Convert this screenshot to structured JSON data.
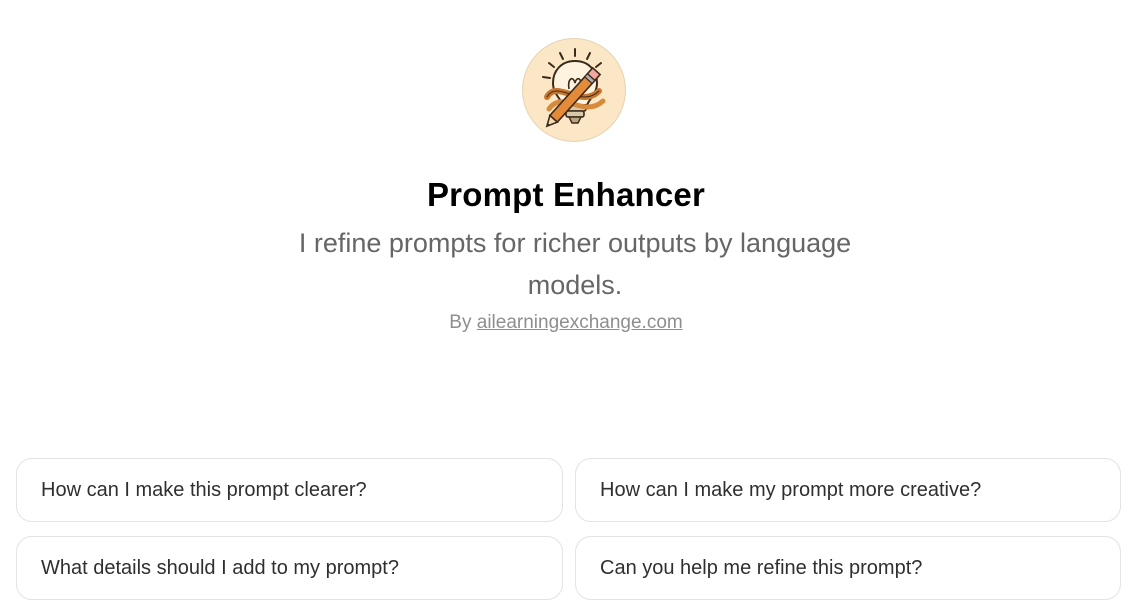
{
  "gpt": {
    "avatar_icon": "lightbulb-pencil-icon",
    "title": "Prompt Enhancer",
    "description": "I refine prompts for richer outputs by language models.",
    "author_prefix": "By",
    "author_link": "ailearningexchange.com"
  },
  "starters": [
    "How can I make this prompt clearer?",
    "How can I make my prompt more creative?",
    "What details should I add to my prompt?",
    "Can you help me refine this prompt?"
  ],
  "colors": {
    "avatar_background": "#fbe7c6",
    "card_border": "#e3e3e3",
    "muted_text": "#8e8e8e"
  }
}
